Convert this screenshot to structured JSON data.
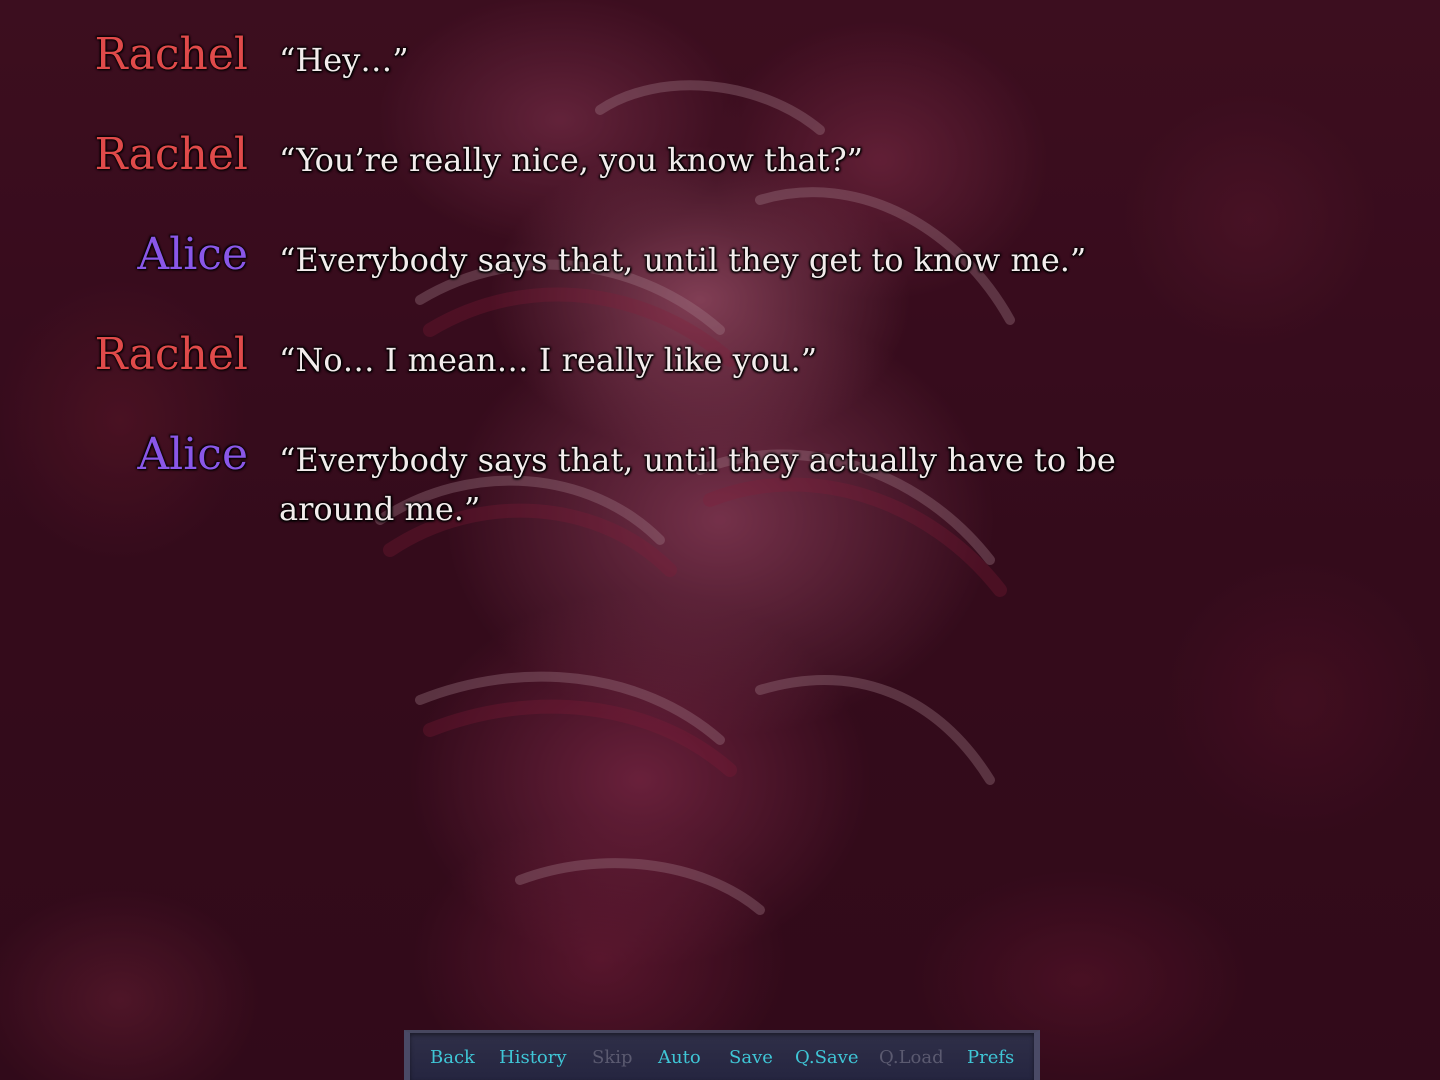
{
  "colors": {
    "rachel": "#e04a4a",
    "alice": "#8a57e8",
    "dialogue_text": "#f3ecec",
    "menu_active": "#3fc6d6",
    "menu_disabled": "#5b5a70"
  },
  "history": [
    {
      "speaker": "Rachel",
      "text": "“Hey…”"
    },
    {
      "speaker": "Rachel",
      "text": "“You’re really nice, you know that?”"
    },
    {
      "speaker": "Alice",
      "text": "“Everybody says that, until they get to know me.”"
    },
    {
      "speaker": "Rachel",
      "text": "“No… I mean… I really like you.”"
    },
    {
      "speaker": "Alice",
      "text": "“Everybody says that, until they actually have to be around me.”"
    }
  ],
  "quick_menu": [
    {
      "label": "Back",
      "enabled": true
    },
    {
      "label": "History",
      "enabled": true
    },
    {
      "label": "Skip",
      "enabled": false
    },
    {
      "label": "Auto",
      "enabled": true
    },
    {
      "label": "Save",
      "enabled": true
    },
    {
      "label": "Q.Save",
      "enabled": true
    },
    {
      "label": "Q.Load",
      "enabled": false
    },
    {
      "label": "Prefs",
      "enabled": true
    }
  ]
}
